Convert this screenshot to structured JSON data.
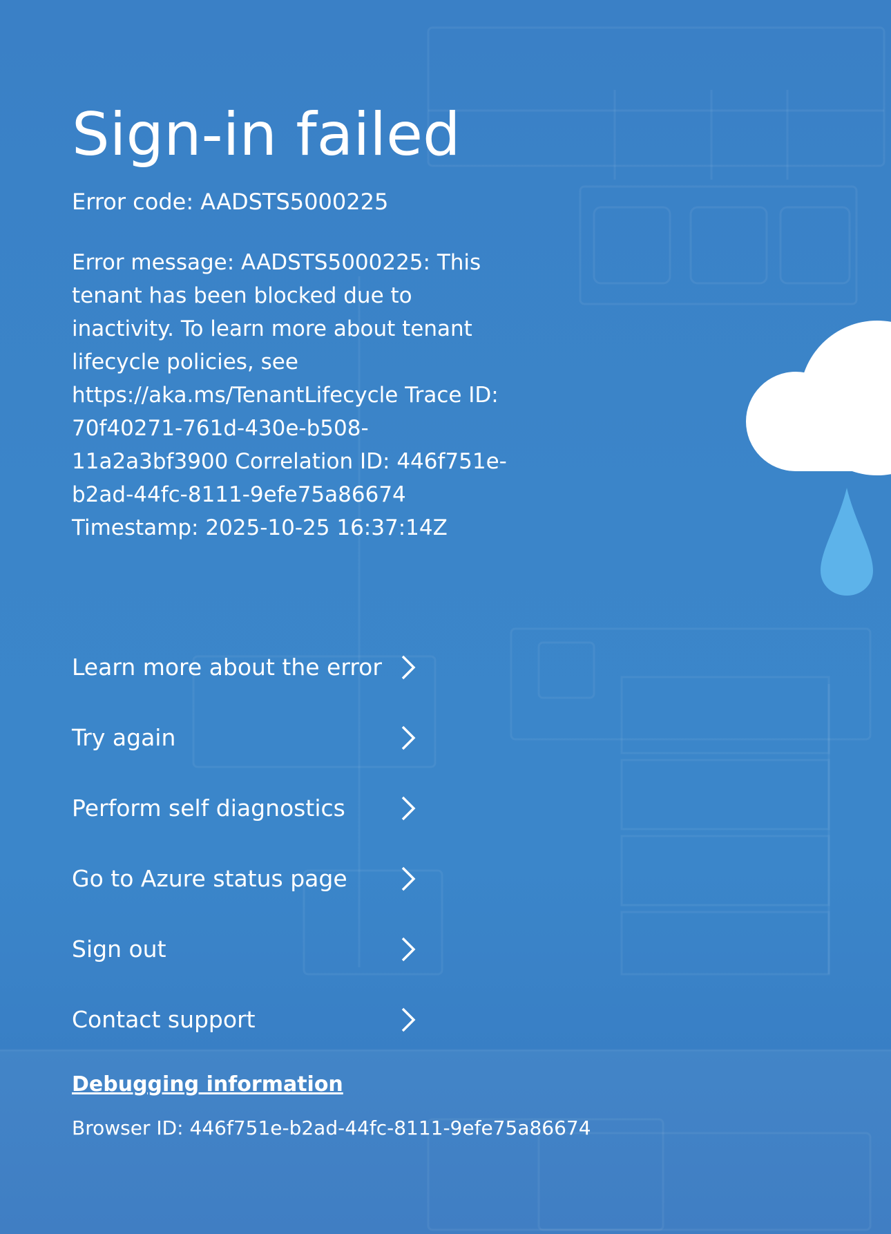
{
  "page": {
    "title": "Sign-in failed",
    "error_code": "Error code: AADSTS5000225",
    "error_message": "Error message: AADSTS5000225: This tenant has been blocked due to inactivity. To learn more about tenant lifecycle policies, see https://aka.ms/TenantLifecycle Trace ID: 70f40271-761d-430e-b508-11a2a3bf3900 Correlation ID: 446f751e-b2ad-44fc-8111-9efe75a86674 Timestamp: 2025-10-25 16:37:14Z"
  },
  "actions": [
    {
      "label": "Learn more about the error",
      "icon": "chevron-right-icon"
    },
    {
      "label": "Try again",
      "icon": "chevron-right-icon"
    },
    {
      "label": "Perform self diagnostics",
      "icon": "chevron-right-icon"
    },
    {
      "label": "Go to Azure status page",
      "icon": "chevron-right-icon"
    },
    {
      "label": "Sign out",
      "icon": "chevron-right-icon"
    },
    {
      "label": "Contact support",
      "icon": "chevron-right-icon"
    }
  ],
  "debug": {
    "link_label": "Debugging information",
    "browser_id": "Browser ID: 446f751e-b2ad-44fc-8111-9efe75a86674"
  },
  "colors": {
    "background": "#3a82c7",
    "text": "#ffffff",
    "cloud": "#ffffff",
    "raindrop": "#5db3ea"
  },
  "decorations": {
    "illustration": "cloud-with-raindrop-icon"
  }
}
